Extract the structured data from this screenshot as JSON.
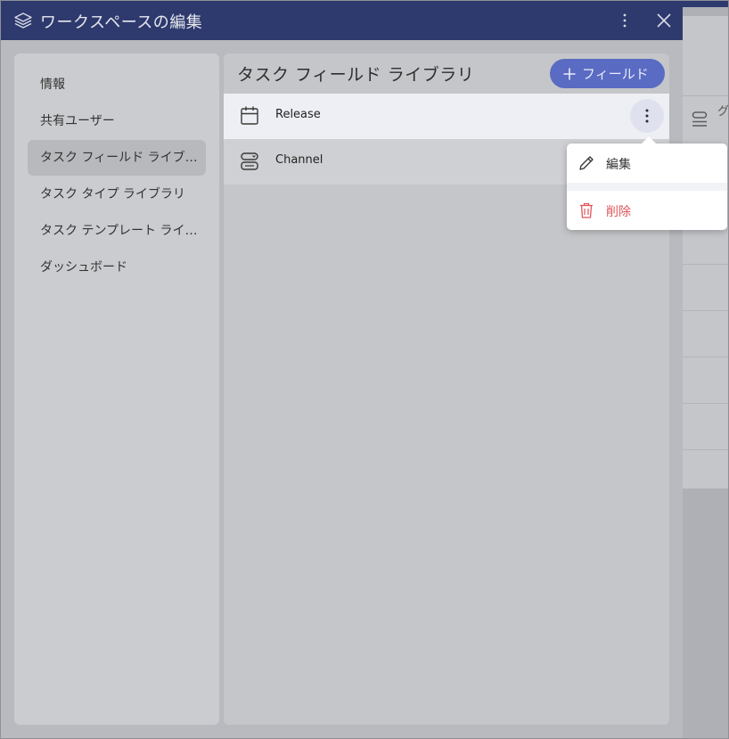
{
  "window": {
    "title": "ワークスペースの編集",
    "icons": {
      "app": "layers-icon",
      "more": "more-vertical-icon",
      "close": "close-icon"
    }
  },
  "sidebar": {
    "items": [
      {
        "label": "情報",
        "active": false
      },
      {
        "label": "共有ユーザー",
        "active": false
      },
      {
        "label": "タスク フィールド ライブラリ",
        "active": true
      },
      {
        "label": "タスク タイプ ライブラリ",
        "active": false
      },
      {
        "label": "タスク テンプレート ライブラリ",
        "active": false
      },
      {
        "label": "ダッシュボード",
        "active": false
      }
    ]
  },
  "main": {
    "title": "タスク フィールド ライブラリ",
    "add_button": {
      "label": "フィールド",
      "icon": "plus-icon"
    },
    "fields": [
      {
        "label": "Release",
        "icon": "calendar-icon"
      },
      {
        "label": "Channel",
        "icon": "dropdown-field-icon"
      }
    ]
  },
  "context_menu": {
    "items": [
      {
        "label": "編集",
        "icon": "pencil-icon"
      },
      {
        "label": "削除",
        "icon": "trash-icon"
      }
    ]
  },
  "background": {
    "partial_text": "グ セ"
  },
  "colors": {
    "titlebar": "#2e3a6e",
    "accent_button": "#5a6bc4",
    "delete_red": "#e0555a"
  }
}
